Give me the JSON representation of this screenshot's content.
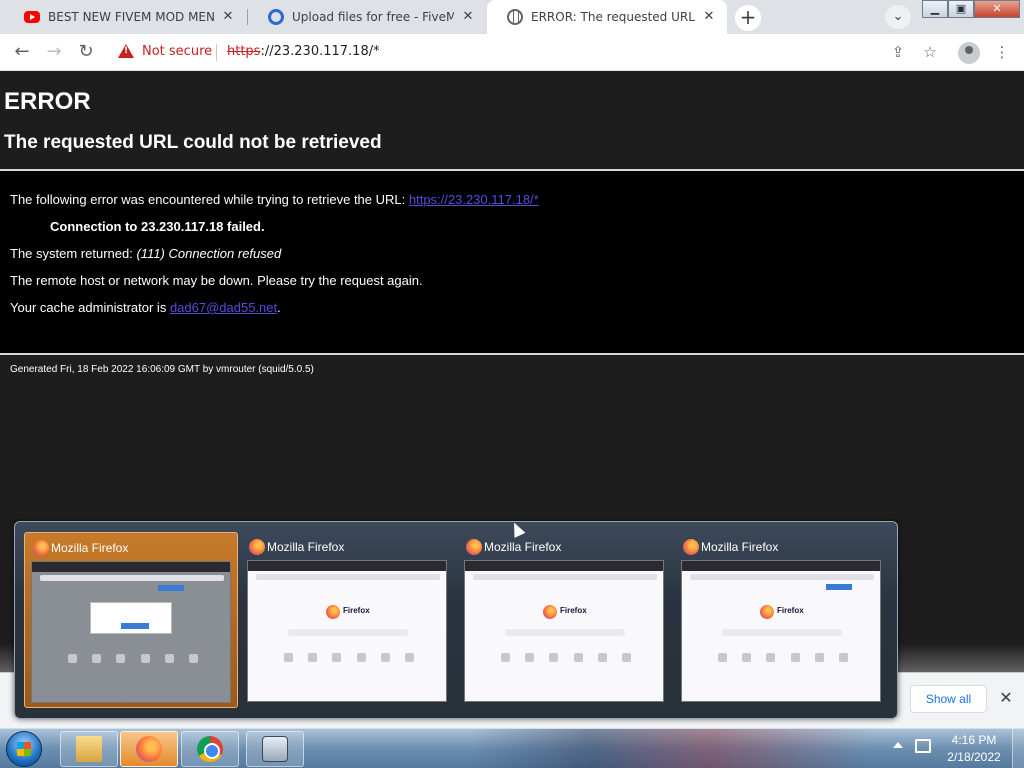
{
  "browser": {
    "tabs": [
      {
        "title": "BEST NEW FIVEM MOD MENU | F",
        "favicon": "youtube-icon",
        "active": false
      },
      {
        "title": "Upload files for free - FiveM Hac",
        "favicon": "fivem-icon",
        "active": false
      },
      {
        "title": "ERROR: The requested URL could",
        "favicon": "globe-icon",
        "active": true
      }
    ],
    "tab_close_glyph": "✕",
    "new_tab_glyph": "+",
    "tab_search_glyph": "⌄",
    "window_buttons": {
      "minimize": "▁",
      "maximize": "▣",
      "close": "✕"
    },
    "nav": {
      "back": "←",
      "forward": "→",
      "reload": "↻"
    },
    "security_label": "Not secure",
    "url_scheme": "https",
    "url_rest": "://23.230.117.18/*",
    "share_glyph": "⇪",
    "bookmark_glyph": "☆",
    "menu_glyph": "⋮"
  },
  "page": {
    "h1": "ERROR",
    "h2": "The requested URL could not be retrieved",
    "line1_text": "The following error was encountered while trying to retrieve the URL: ",
    "line1_link": "https://23.230.117.18/*",
    "line2": "Connection to 23.230.117.18 failed.",
    "line3_prefix": "The system returned: ",
    "line3_em": "(111) Connection refused",
    "line4": "The remote host or network may be down. Please try the request again.",
    "line5_prefix": "Your cache administrator is ",
    "line5_link": "dad67@dad55.net",
    "line5_suffix": ".",
    "footer": "Generated Fri, 18 Feb 2022 16:06:09 GMT by vmrouter (squid/5.0.5)"
  },
  "download_bar": {
    "show_all": "Show all",
    "close_glyph": "✕"
  },
  "taskbar_preview": {
    "thumbnails": [
      {
        "title": "Mozilla Firefox",
        "selected": true
      },
      {
        "title": "Mozilla Firefox",
        "selected": false
      },
      {
        "title": "Mozilla Firefox",
        "selected": false
      },
      {
        "title": "Mozilla Firefox",
        "selected": false
      }
    ],
    "thumbnail_logo_text": "Firefox"
  },
  "taskbar": {
    "apps": [
      "folder-icon",
      "firefox-icon",
      "chrome-icon",
      "monitor-icon"
    ],
    "active_app": "firefox-icon",
    "time": "4:16 PM",
    "date": "2/18/2022"
  },
  "colors": {
    "page_bg": "#1d1d1d",
    "error_block_bg": "#000000",
    "link": "#5a4bd8",
    "not_secure": "#c5221f",
    "thumb_selected": "#c77a2a"
  }
}
